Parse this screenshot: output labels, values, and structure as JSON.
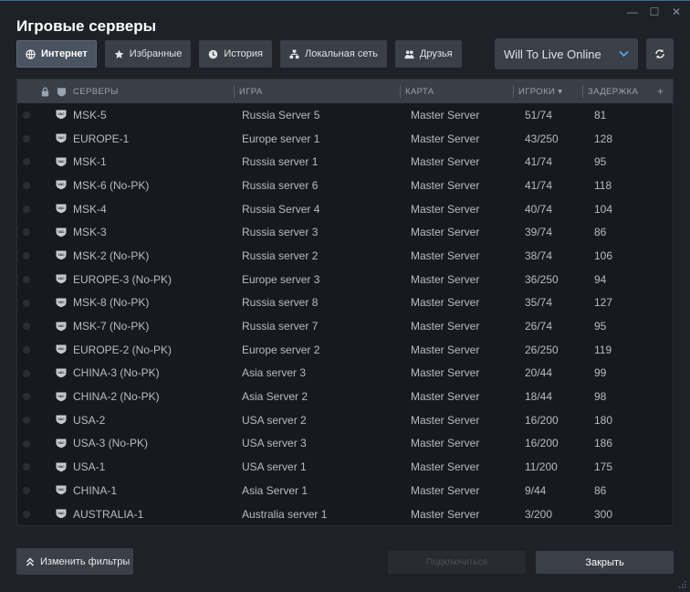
{
  "window": {
    "title": "Игровые серверы",
    "controls": [
      {
        "name": "minimize",
        "glyph": "—"
      },
      {
        "name": "maximize",
        "glyph": "☐"
      },
      {
        "name": "close",
        "glyph": "✕"
      }
    ]
  },
  "tabs": [
    {
      "key": "internet",
      "label": "Интернет",
      "active": true,
      "icon": "globe-icon"
    },
    {
      "key": "favorites",
      "label": "Избранные",
      "active": false,
      "icon": "star-icon"
    },
    {
      "key": "history",
      "label": "История",
      "active": false,
      "icon": "clock-icon"
    },
    {
      "key": "lan",
      "label": "Локальная сеть",
      "active": false,
      "icon": "network-icon"
    },
    {
      "key": "friends",
      "label": "Друзья",
      "active": false,
      "icon": "friends-icon"
    }
  ],
  "game_filter": {
    "selected": "Will To Live Online",
    "icon": "chevron-down-icon"
  },
  "refresh": {
    "icon": "refresh-icon"
  },
  "table": {
    "headers": {
      "servers": "СЕРВЕРЫ",
      "game": "ИГРА",
      "map": "КАРТА",
      "players": "ИГРОКИ",
      "latency": "ЗАДЕРЖКА",
      "add": "+"
    },
    "sort_indicator": "▾",
    "rows": [
      {
        "server": "MSK-5",
        "game": "Russia Server 5",
        "map": "Master Server",
        "players": "51/74",
        "latency": "81"
      },
      {
        "server": "EUROPE-1",
        "game": "Europe server 1",
        "map": "Master Server",
        "players": "43/250",
        "latency": "128"
      },
      {
        "server": "MSK-1",
        "game": "Russia server 1",
        "map": "Master Server",
        "players": "41/74",
        "latency": "95"
      },
      {
        "server": "MSK-6 (No-PK)",
        "game": "Russia server 6",
        "map": "Master Server",
        "players": "41/74",
        "latency": "118"
      },
      {
        "server": "MSK-4",
        "game": "Russia Server 4",
        "map": "Master Server",
        "players": "40/74",
        "latency": "104"
      },
      {
        "server": "MSK-3",
        "game": "Russia server 3",
        "map": "Master Server",
        "players": "39/74",
        "latency": "86"
      },
      {
        "server": "MSK-2 (No-PK)",
        "game": "Russia server 2",
        "map": "Master Server",
        "players": "38/74",
        "latency": "106"
      },
      {
        "server": "EUROPE-3 (No-PK)",
        "game": "Europe server 3",
        "map": "Master Server",
        "players": "36/250",
        "latency": "94"
      },
      {
        "server": "MSK-8 (No-PK)",
        "game": "Russia server 8",
        "map": "Master Server",
        "players": "35/74",
        "latency": "127"
      },
      {
        "server": "MSK-7 (No-PK)",
        "game": "Russia server 7",
        "map": "Master Server",
        "players": "26/74",
        "latency": "95"
      },
      {
        "server": "EUROPE-2 (No-PK)",
        "game": "Europe server 2",
        "map": "Master Server",
        "players": "26/250",
        "latency": "119"
      },
      {
        "server": "CHINA-3 (No-PK)",
        "game": "Asia server 3",
        "map": "Master Server",
        "players": "20/44",
        "latency": "99"
      },
      {
        "server": "CHINA-2 (No-PK)",
        "game": "Asia Server 2",
        "map": "Master Server",
        "players": "18/44",
        "latency": "98"
      },
      {
        "server": "USA-2",
        "game": "USA server 2",
        "map": "Master Server",
        "players": "16/200",
        "latency": "180"
      },
      {
        "server": "USA-3 (No-PK)",
        "game": "USA server 3",
        "map": "Master Server",
        "players": "16/200",
        "latency": "186"
      },
      {
        "server": "USA-1",
        "game": "USA server 1",
        "map": "Master Server",
        "players": "11/200",
        "latency": "175"
      },
      {
        "server": "CHINA-1",
        "game": "Asia Server 1",
        "map": "Master Server",
        "players": "9/44",
        "latency": "86"
      },
      {
        "server": "AUSTRALIA-1",
        "game": "Australia server 1",
        "map": "Master Server",
        "players": "3/200",
        "latency": "300"
      }
    ]
  },
  "footer": {
    "change_filters": "Изменить фильтры",
    "connect": "Подключиться",
    "close": "Закрыть"
  },
  "colors": {
    "background": "#1e2127",
    "table_bg": "#161a20",
    "header_bg": "#3a3e46",
    "accent": "#4cb1ff",
    "text": "#b8bcbf"
  }
}
